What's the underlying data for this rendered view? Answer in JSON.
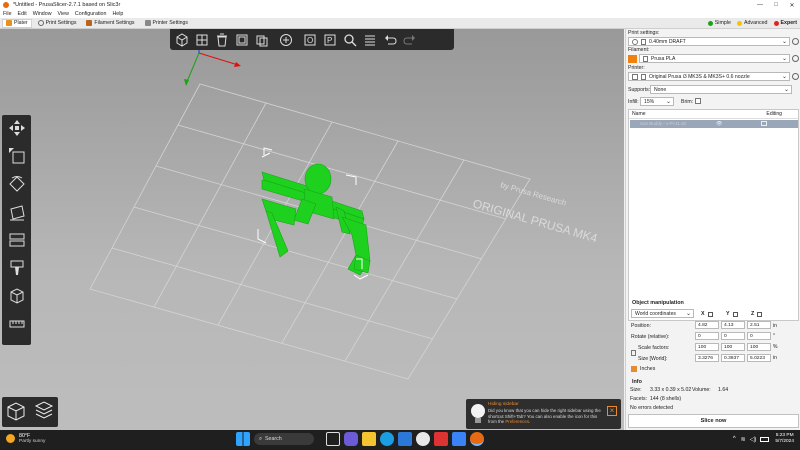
{
  "window": {
    "title": "*Untitled - PrusaSlicer-2.7.1 based on Slic3r",
    "controls": [
      "—",
      "□",
      "✕"
    ]
  },
  "menu": [
    "File",
    "Edit",
    "Window",
    "View",
    "Configuration",
    "Help"
  ],
  "tabs": [
    "Plater",
    "Print Settings",
    "Filament Settings",
    "Printer Settings"
  ],
  "modes": {
    "simple": "Simple",
    "advanced": "Advanced",
    "expert": "Expert",
    "colors": {
      "simple": "#18a418",
      "advanced": "#f5c400",
      "expert": "#e62020"
    }
  },
  "viewport": {
    "bed_label_line1": "ORIGINAL PRUSA MK4",
    "bed_label_line2": "by Prusa Research",
    "model_color": "#1fd11f"
  },
  "notification": {
    "title": "Hiding sidebar",
    "body": "Did you know that you can hide the right sidebar using the shortcut Shift+Tab? You can also enable the icon for this from the",
    "link": "Preferences",
    "end": "."
  },
  "sidebar": {
    "print_settings_label": "Print settings:",
    "print_settings_value": "0.40mm DRAFT",
    "filament_label": "Filament:",
    "filament_value": "Prusa PLA",
    "filament_color": "#f08010",
    "printer_label": "Printer:",
    "printer_value": "Original Prusa i3 MK3S & MK3S+ 0.6 nozzle",
    "supports_label": "Supports:",
    "supports_value": "None",
    "infill_label": "Infill:",
    "infill_value": "15%",
    "brim_label": "Brim:",
    "list_headers": {
      "name": "Name",
      "editing": "Editing"
    },
    "object_name": "Sun Buddy - v-Pi-11.stl",
    "object_manipulation": {
      "title": "Object manipulation",
      "coords": "World coordinates",
      "axes": [
        "X",
        "Y",
        "Z"
      ],
      "position_label": "Position:",
      "position": [
        "4.82",
        "4.13",
        "2.51"
      ],
      "position_unit": "in",
      "rotate_label": "Rotate (relative):",
      "rotate": [
        "0",
        "0",
        "0"
      ],
      "rotate_unit": "°",
      "scale_label": "Scale factors:",
      "scale": [
        "100",
        "100",
        "100"
      ],
      "scale_unit": "%",
      "size_label": "Size [World]:",
      "size": [
        "3.3276",
        "0.3937",
        "5.0223"
      ],
      "size_unit": "in",
      "inches_label": "Inches"
    },
    "info": {
      "title": "Info",
      "size_label": "Size:",
      "size_value": "3.33 x 0.39 x 5.02",
      "volume_label": "Volume:",
      "volume_value": "1.64",
      "facets_label": "Facets:",
      "facets_value": "144 (8 shells)",
      "errors": "No errors detected"
    },
    "slice_button": "Slice now"
  },
  "taskbar": {
    "temp": "80°F",
    "condition": "Partly sunny",
    "search": "Search",
    "time": "5:23 PM",
    "date": "5/7/2024"
  }
}
